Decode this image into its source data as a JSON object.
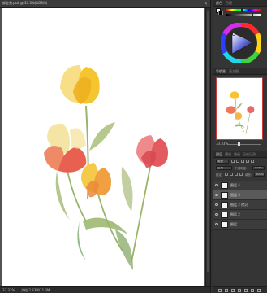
{
  "document": {
    "tab_title": "郁金香.psd @ 33.3%(RGB/8)",
    "close_glyph": "×"
  },
  "status": {
    "zoom": "33.33%",
    "doc_info": "文档:2.83M/11.3M"
  },
  "color_panel": {
    "tabs": [
      "颜色",
      "色板"
    ],
    "foreground": "#ffffff",
    "background": "#000000"
  },
  "navigator": {
    "tabs": [
      "导航器",
      "直方图"
    ],
    "zoom": "33.33%"
  },
  "layers_panel": {
    "tabs": [
      "图层",
      "通道",
      "路径",
      "历史记录"
    ],
    "kind_label": "类型",
    "blend_mode": "正常",
    "opacity_label": "不透明度:",
    "opacity_value": "100%",
    "lock_label": "锁定:",
    "fill_label": "填充:",
    "fill_value": "100%",
    "layers": [
      {
        "name": "图层 4",
        "selected": false
      },
      {
        "name": "图层 3",
        "selected": true
      },
      {
        "name": "图层 2 拷贝",
        "selected": false
      },
      {
        "name": "图层 2",
        "selected": false
      },
      {
        "name": "图层 1",
        "selected": false
      }
    ]
  },
  "colors": {
    "petal_yellow": "#f5c531",
    "petal_red": "#e8604f",
    "petal_pink": "#ef8a8c",
    "stem_green": "#9ab46a",
    "selection_outline": "#c83c3c"
  }
}
